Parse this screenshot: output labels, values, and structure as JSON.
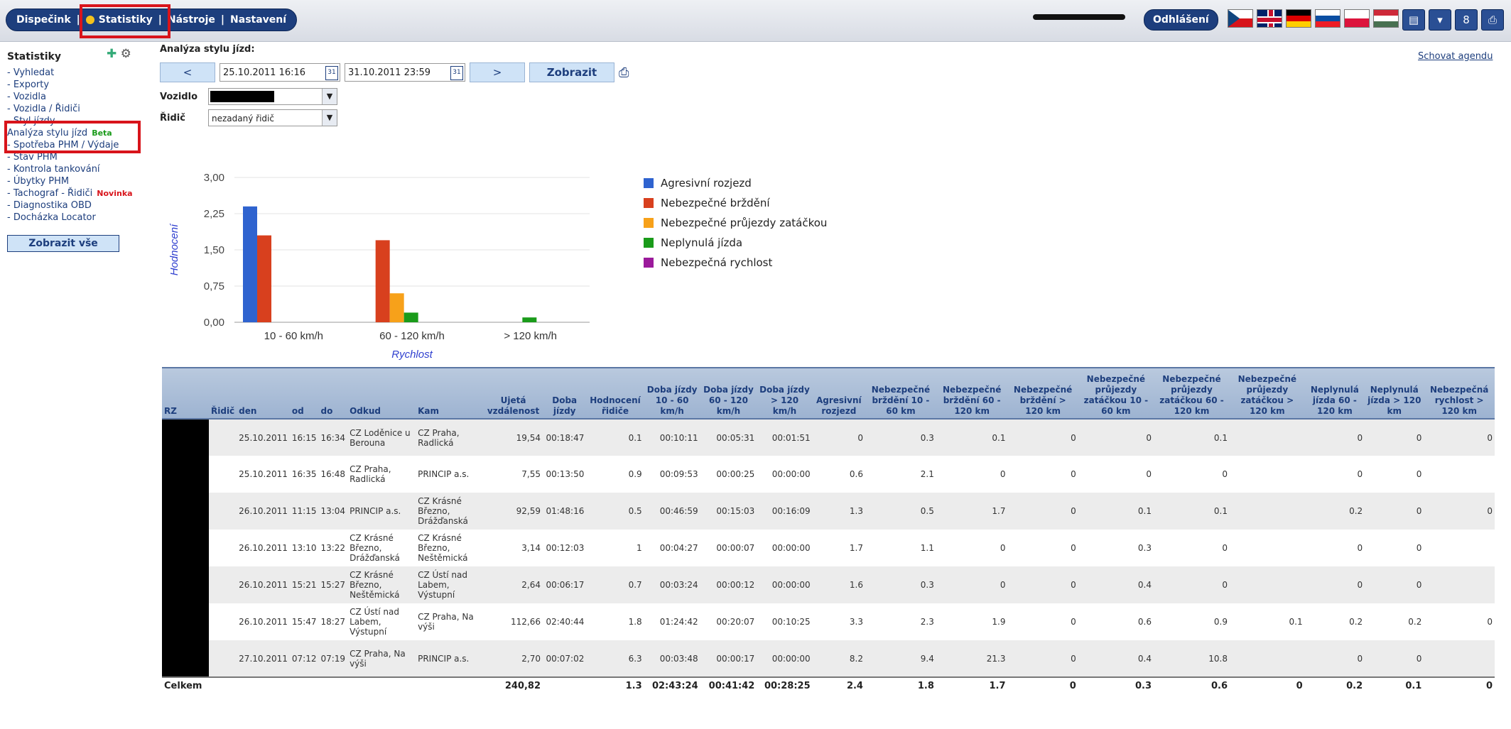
{
  "nav": {
    "dispecink": "Dispečink",
    "statistiky": "Statistiky",
    "nastroje": "Nástroje",
    "nastaveni": "Nastavení",
    "logout": "Odhlášení"
  },
  "sidebar": {
    "title": "Statistiky",
    "items": [
      "- Vyhledat",
      "- Exporty",
      "- Vozidla",
      "- Vozidla / Řidiči",
      "- Styl jízdy",
      "Analýza stylu jízd",
      "- Spotřeba PHM / Výdaje",
      "- Stav PHM",
      "- Kontrola tankování",
      "- Úbytky PHM",
      "- Tachograf - Řidiči",
      "- Diagnostika OBD",
      "- Docházka Locator"
    ],
    "beta": "Beta",
    "novinka": "Novinka",
    "show_all": "Zobrazit vše"
  },
  "main": {
    "title": "Analýza stylu jízd:",
    "prev": "<",
    "next": ">",
    "date_from": "25.10.2011 16:16",
    "date_to": "31.10.2011 23:59",
    "show": "Zobrazit",
    "vehicle_label": "Vozidlo",
    "driver_label": "Řidič",
    "driver_value": "nezadaný řidič",
    "hide_agenda": "Schovat agendu"
  },
  "chart_data": {
    "type": "bar",
    "categories": [
      "10 - 60 km/h",
      "60 - 120 km/h",
      "> 120 km/h"
    ],
    "series": [
      {
        "name": "Agresivní rozjezd",
        "color": "#2f63cf",
        "values": [
          2.4,
          0,
          0
        ]
      },
      {
        "name": "Nebezpečné brždění",
        "color": "#d8401e",
        "values": [
          1.8,
          1.7,
          0
        ]
      },
      {
        "name": "Nebezpečné průjezdy zatáčkou",
        "color": "#f7a11a",
        "values": [
          0,
          0.6,
          0
        ]
      },
      {
        "name": "Neplynulá jízda",
        "color": "#1a9b1a",
        "values": [
          0,
          0.2,
          0.1
        ]
      },
      {
        "name": "Nebezpečná rychlost",
        "color": "#9b1a9b",
        "values": [
          0,
          0,
          0
        ]
      }
    ],
    "xlabel": "Rychlost",
    "ylabel": "Hodnocení",
    "ylim": [
      0,
      3
    ],
    "yticks": [
      "0,00",
      "0,75",
      "1,50",
      "2,25",
      "3,00"
    ]
  },
  "table": {
    "headers": [
      "RZ",
      "Řidič",
      "den",
      "od",
      "do",
      "Odkud",
      "Kam",
      "Ujetá vzdálenost",
      "Doba jízdy",
      "Hodnocení řidiče",
      "Doba jízdy 10 - 60 km/h",
      "Doba jízdy 60 - 120 km/h",
      "Doba jízdy > 120 km/h",
      "Agresivní rozjezd",
      "Nebezpečné brždění 10 - 60 km",
      "Nebezpečné brždění 60 - 120 km",
      "Nebezpečné brždění > 120 km",
      "Nebezpečné průjezdy zatáčkou 10 - 60 km",
      "Nebezpečné průjezdy zatáčkou 60 - 120 km",
      "Nebezpečné průjezdy zatáčkou > 120 km",
      "Neplynulá jízda 60 - 120 km",
      "Neplynulá jízda > 120 km",
      "Nebezpečná rychlost > 120 km"
    ],
    "rows": [
      [
        "",
        "",
        "25.10.2011",
        "16:15",
        "16:34",
        "CZ Loděnice u Berouna",
        "CZ Praha, Radlická",
        "19,54",
        "00:18:47",
        "0.1",
        "00:10:11",
        "00:05:31",
        "00:01:51",
        "0",
        "0.3",
        "0.1",
        "0",
        "0",
        "0.1",
        "",
        "0",
        "0",
        "0"
      ],
      [
        "",
        "",
        "25.10.2011",
        "16:35",
        "16:48",
        "CZ Praha, Radlická",
        "PRINCIP a.s.",
        "7,55",
        "00:13:50",
        "0.9",
        "00:09:53",
        "00:00:25",
        "00:00:00",
        "0.6",
        "2.1",
        "0",
        "0",
        "0",
        "0",
        "",
        "0",
        "0",
        ""
      ],
      [
        "",
        "",
        "26.10.2011",
        "11:15",
        "13:04",
        "PRINCIP a.s.",
        "CZ Krásné Březno, Drážďanská",
        "92,59",
        "01:48:16",
        "0.5",
        "00:46:59",
        "00:15:03",
        "00:16:09",
        "1.3",
        "0.5",
        "1.7",
        "0",
        "0.1",
        "0.1",
        "",
        "0.2",
        "0",
        "0"
      ],
      [
        "",
        "",
        "26.10.2011",
        "13:10",
        "13:22",
        "CZ Krásné Březno, Drážďanská",
        "CZ Krásné Březno, Neštěmická",
        "3,14",
        "00:12:03",
        "1",
        "00:04:27",
        "00:00:07",
        "00:00:00",
        "1.7",
        "1.1",
        "0",
        "0",
        "0.3",
        "0",
        "",
        "0",
        "0",
        ""
      ],
      [
        "",
        "",
        "26.10.2011",
        "15:21",
        "15:27",
        "CZ Krásné Březno, Neštěmická",
        "CZ Ústí nad Labem, Výstupní",
        "2,64",
        "00:06:17",
        "0.7",
        "00:03:24",
        "00:00:12",
        "00:00:00",
        "1.6",
        "0.3",
        "0",
        "0",
        "0.4",
        "0",
        "",
        "0",
        "0",
        ""
      ],
      [
        "",
        "",
        "26.10.2011",
        "15:47",
        "18:27",
        "CZ Ústí nad Labem, Výstupní",
        "CZ Praha, Na výši",
        "112,66",
        "02:40:44",
        "1.8",
        "01:24:42",
        "00:20:07",
        "00:10:25",
        "3.3",
        "2.3",
        "1.9",
        "0",
        "0.6",
        "0.9",
        "0.1",
        "0.2",
        "0.2",
        "0"
      ],
      [
        "",
        "",
        "27.10.2011",
        "07:12",
        "07:19",
        "CZ Praha, Na výši",
        "PRINCIP a.s.",
        "2,70",
        "00:07:02",
        "6.3",
        "00:03:48",
        "00:00:17",
        "00:00:00",
        "8.2",
        "9.4",
        "21.3",
        "0",
        "0.4",
        "10.8",
        "",
        "0",
        "0",
        ""
      ]
    ],
    "total": [
      "Celkem",
      "240,82",
      "1.3",
      "02:43:24",
      "00:41:42",
      "00:28:25",
      "2.4",
      "1.8",
      "1.7",
      "0",
      "0.3",
      "0.6",
      "0",
      "0.2",
      "0.1",
      "0"
    ]
  }
}
